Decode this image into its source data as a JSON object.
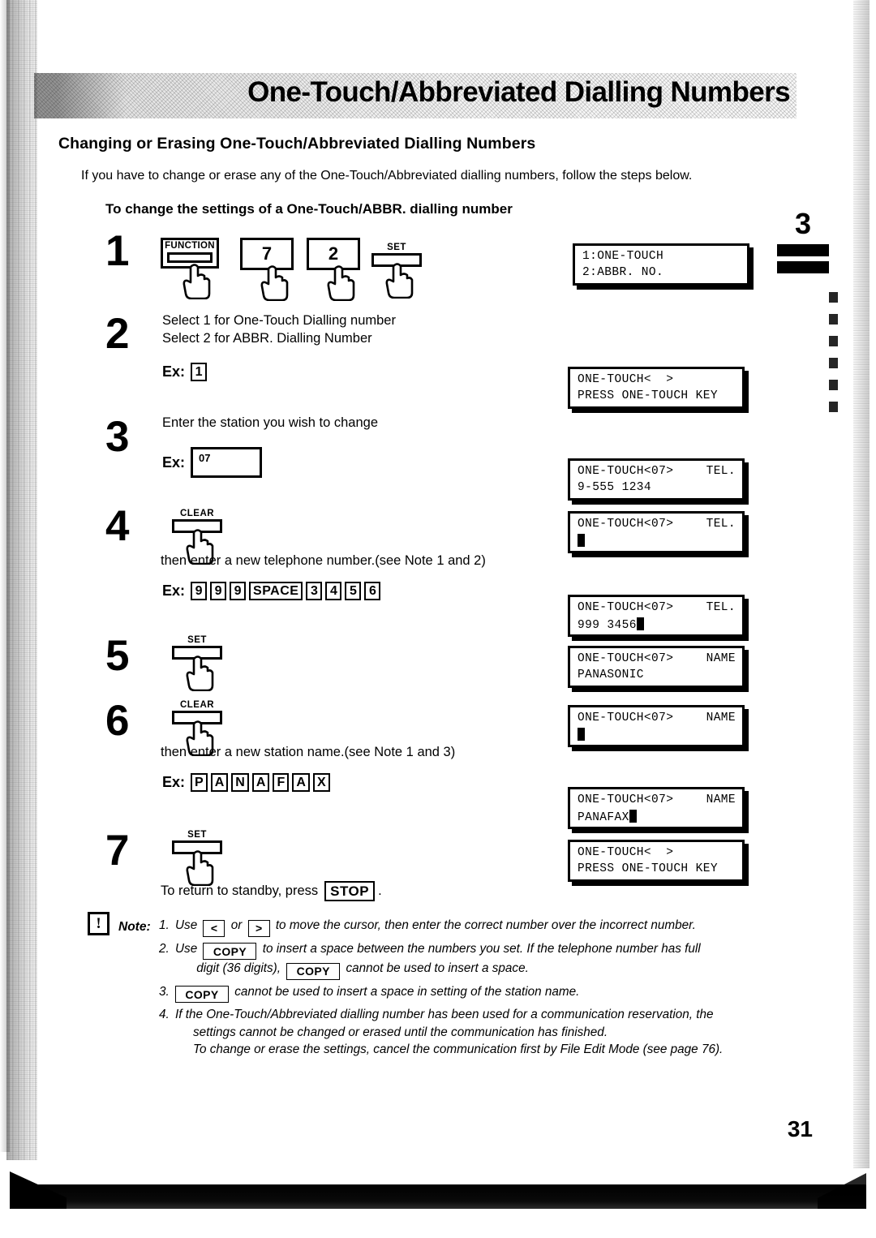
{
  "document": {
    "banner_title": "One-Touch/Abbreviated Dialling Numbers",
    "section_heading": "Changing or Erasing One-Touch/Abbreviated Dialling Numbers",
    "intro": "If you have to change or erase any of the One-Touch/Abbreviated dialling numbers, follow the steps below.",
    "subheading": "To change the settings of a One-Touch/ABBR. dialling number",
    "tab_marker": "3",
    "page_number": "31"
  },
  "steps": [
    {
      "number": "1",
      "keys": [
        {
          "label": "FUNCTION",
          "type": "function-key"
        },
        {
          "label": "7",
          "type": "numeric-key"
        },
        {
          "label": "2",
          "type": "numeric-key"
        },
        {
          "label": "SET",
          "type": "flat-key"
        }
      ]
    },
    {
      "number": "2",
      "lines": [
        "Select 1 for One-Touch Dialling number",
        "Select 2 for ABBR. Dialling Number"
      ],
      "example_label": "Ex:",
      "example_keys": [
        "1"
      ]
    },
    {
      "number": "3",
      "lines": [
        "Enter the station you wish to change"
      ],
      "example_label": "Ex:",
      "example_value": "07"
    },
    {
      "number": "4",
      "keys": [
        {
          "label": "CLEAR",
          "type": "flat-key"
        }
      ],
      "lines": [
        "then enter a new telephone number.(see Note 1 and 2)"
      ],
      "example_label": "Ex:",
      "example_keys": [
        "9",
        "9",
        "9",
        "SPACE",
        "3",
        "4",
        "5",
        "6"
      ]
    },
    {
      "number": "5",
      "keys": [
        {
          "label": "SET",
          "type": "flat-key"
        }
      ]
    },
    {
      "number": "6",
      "keys": [
        {
          "label": "CLEAR",
          "type": "flat-key"
        }
      ],
      "lines": [
        "then enter a new station name.(see Note 1 and 3)"
      ],
      "example_label": "Ex:",
      "example_keys": [
        "P",
        "A",
        "N",
        "A",
        "F",
        "A",
        "X"
      ]
    },
    {
      "number": "7",
      "keys": [
        {
          "label": "SET",
          "type": "flat-key"
        }
      ],
      "standby_prefix": "To return to standby, press",
      "standby_key": "STOP",
      "standby_suffix": "."
    }
  ],
  "displays": [
    {
      "line1_left": "1:ONE-TOUCH",
      "line1_right": "",
      "line2": "2:ABBR. NO.",
      "cursor": false
    },
    {
      "line1_left": "ONE-TOUCH<  >",
      "line1_right": "",
      "line2": "PRESS ONE-TOUCH KEY",
      "cursor": false
    },
    {
      "line1_left": "ONE-TOUCH<07>",
      "line1_right": "TEL.",
      "line2": "9-555 1234",
      "cursor": false
    },
    {
      "line1_left": "ONE-TOUCH<07>",
      "line1_right": "TEL.",
      "line2": "",
      "cursor": true
    },
    {
      "line1_left": "ONE-TOUCH<07>",
      "line1_right": "TEL.",
      "line2": "999 3456",
      "cursor": true
    },
    {
      "line1_left": "ONE-TOUCH<07>",
      "line1_right": "NAME",
      "line2": "PANASONIC",
      "cursor": false
    },
    {
      "line1_left": "ONE-TOUCH<07>",
      "line1_right": "NAME",
      "line2": "",
      "cursor": true
    },
    {
      "line1_left": "ONE-TOUCH<07>",
      "line1_right": "NAME",
      "line2": "PANAFAX",
      "cursor": true
    },
    {
      "line1_left": "ONE-TOUCH<  >",
      "line1_right": "",
      "line2": "PRESS ONE-TOUCH KEY",
      "cursor": false
    }
  ],
  "note_block": {
    "icon": "!",
    "label": "Note:",
    "items": [
      {
        "index": "1.",
        "part1": "Use",
        "key1": "<",
        "mid": "or",
        "key2": ">",
        "part2": "to move the cursor, then enter the correct number over the incorrect number."
      },
      {
        "index": "2.",
        "part1": "Use",
        "key1": "COPY",
        "part2": "to insert a space between the numbers you set. If the telephone number has full",
        "part3": "digit (36 digits),",
        "key2": "COPY",
        "part4": "cannot be used to insert a space."
      },
      {
        "index": "3.",
        "key1": "COPY",
        "part2": "cannot be used to insert a space in setting of the station name."
      },
      {
        "index": "4.",
        "part1": "If the One-Touch/Abbreviated dialling number has been used for a communication reservation, the",
        "part2": "settings cannot be changed or erased until the communication has finished.",
        "part3": "To change or erase the settings, cancel the communication first by File Edit Mode (see page 76)."
      }
    ]
  }
}
